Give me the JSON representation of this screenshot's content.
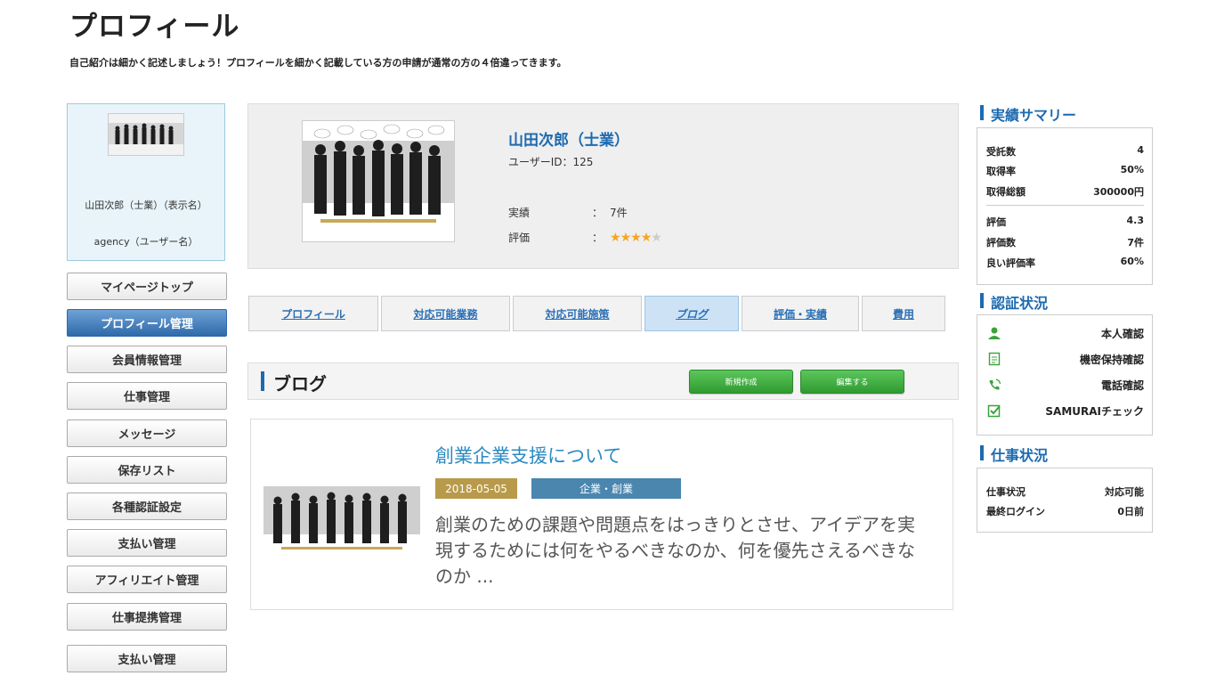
{
  "page": {
    "title": "プロフィール",
    "subtitle": "自己紹介は細かく記述しましょう！プロフィールを細かく記載している方の申請が通常の方の４倍違ってきます。"
  },
  "user_card": {
    "display_name": "山田次郎（士業）（表示名）",
    "login_name": "agency（ユーザー名）"
  },
  "menu": [
    {
      "label": "マイページトップ",
      "active": false
    },
    {
      "label": "プロフィール管理",
      "active": true
    },
    {
      "label": "会員情報管理",
      "active": false
    },
    {
      "label": "仕事管理",
      "active": false
    },
    {
      "label": "メッセージ",
      "active": false
    },
    {
      "label": "保存リスト",
      "active": false
    },
    {
      "label": "各種認証設定",
      "active": false
    },
    {
      "label": "支払い管理",
      "active": false
    },
    {
      "label": "アフィリエイト管理",
      "active": false
    },
    {
      "label": "仕事提携管理",
      "active": false
    },
    {
      "label": "支払い管理",
      "active": false
    }
  ],
  "profile": {
    "name": "山田次郎（士業）",
    "user_id": "ユーザーID：125",
    "results_label": "実績",
    "results_value": "7件",
    "rating_label": "評価",
    "separator": "：",
    "rating_stars": 4,
    "rating_max": 5
  },
  "tabs": [
    {
      "label": "プロフィール",
      "active": false
    },
    {
      "label": "対応可能業務",
      "active": false
    },
    {
      "label": "対応可能施策",
      "active": false
    },
    {
      "label": "ブログ",
      "active": true
    },
    {
      "label": "評価・実績",
      "active": false
    },
    {
      "label": "費用",
      "active": false
    }
  ],
  "blog": {
    "section_title": "ブログ",
    "new_button": "新規作成",
    "edit_button": "編集する",
    "post": {
      "title": "創業企業支援について",
      "date": "2018-05-05",
      "category": "企業・創業",
      "excerpt": "創業のための課題や問題点をはっきりとさせ、アイデアを実現するためには何をやるべきなのか、何を優先さえるべきなのか ..."
    }
  },
  "summary": {
    "heading": "実績サマリー",
    "rows": [
      {
        "label": "受託数",
        "value": "4"
      },
      {
        "label": "取得率",
        "value": "50%"
      },
      {
        "label": "取得総額",
        "value": "300000円"
      },
      {
        "label": "評価",
        "value": "4.3"
      },
      {
        "label": "評価数",
        "value": "7件"
      },
      {
        "label": "良い評価率",
        "value": "60%"
      }
    ]
  },
  "certification": {
    "heading": "認証状況",
    "items": [
      {
        "label": "本人確認",
        "icon": "person-icon"
      },
      {
        "label": "機密保持確認",
        "icon": "document-icon"
      },
      {
        "label": "電話確認",
        "icon": "phone-icon"
      },
      {
        "label": "SAMURAIチェック",
        "icon": "checkbox-icon"
      }
    ]
  },
  "work_status": {
    "heading": "仕事状況",
    "rows": [
      {
        "label": "仕事状況",
        "value": "対応可能"
      },
      {
        "label": "最終ログイン",
        "value": "0日前"
      }
    ]
  },
  "colors": {
    "accent": "#1c6ab0",
    "link": "#2a6fb5",
    "green": "#3aa33a",
    "date_badge": "#b89a4a",
    "category_badge": "#4a86ae"
  }
}
